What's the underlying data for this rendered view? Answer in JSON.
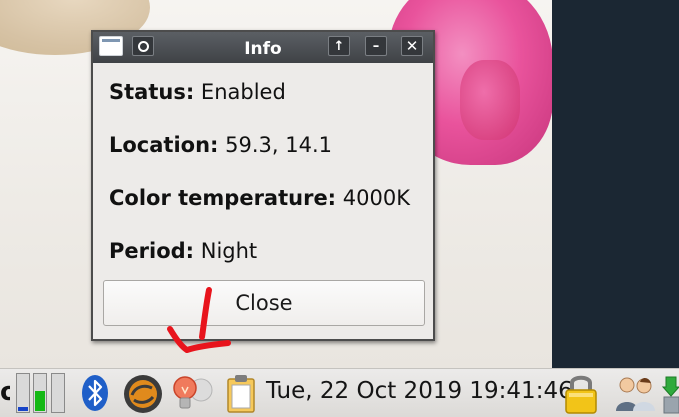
{
  "dialog": {
    "title": "Info",
    "lines": [
      {
        "label": "Status:",
        "value": "Enabled"
      },
      {
        "label": "Location:",
        "value": "59.3, 14.1"
      },
      {
        "label": "Color temperature:",
        "value": "4000K"
      },
      {
        "label": "Period:",
        "value": "Night"
      }
    ],
    "close_label": "Close"
  },
  "titlebar_buttons": [
    "window-menu-icon",
    "sticky-icon",
    "shade-up-icon",
    "minimize-icon",
    "close-icon"
  ],
  "titlebar_glyphs": {
    "up": "↑",
    "minimize": "–",
    "close": "✕"
  },
  "taskbar": {
    "partial_label": "o",
    "cpu_meters": [
      {
        "color": "#1743c8",
        "level": 0.1
      },
      {
        "color": "#14b814",
        "level": 0.5
      }
    ],
    "icons": [
      "bluetooth-icon",
      "update-manager-icon",
      "redshift-lightbulb-icon",
      "clipboard-icon",
      "lock-icon",
      "users-icon",
      "download-icon"
    ],
    "clock": "Tue, 22 Oct 2019 19:41:46"
  },
  "colors": {
    "titlebar": "#4a4d51",
    "annotation_arrow": "#e8141c",
    "pink_blob": "#e9539c",
    "dark_panel": "#1b2733"
  }
}
